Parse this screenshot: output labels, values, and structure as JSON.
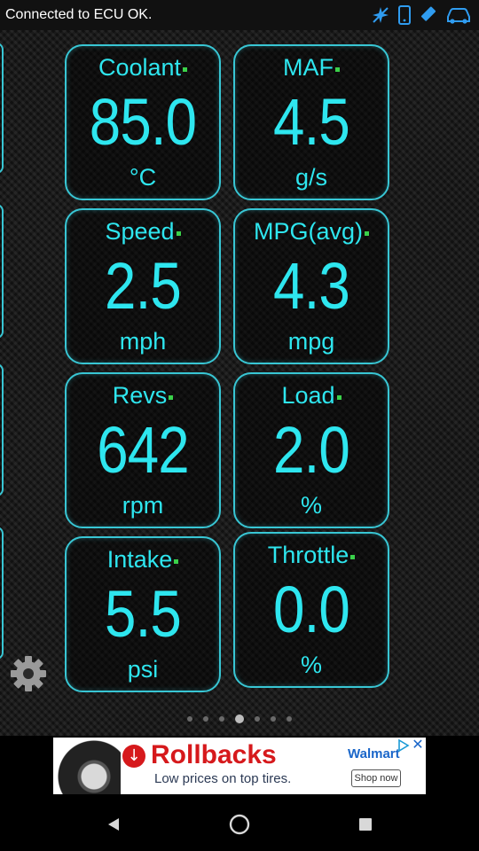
{
  "status_bar": {
    "text": "Connected to ECU OK.",
    "icons": [
      "gps-off-icon",
      "phone-icon",
      "usb-icon",
      "car-icon"
    ]
  },
  "gauges": [
    {
      "label": "Coolant",
      "value": "85.0",
      "unit": "°C"
    },
    {
      "label": "MAF",
      "value": "4.5",
      "unit": "g/s"
    },
    {
      "label": "Speed",
      "value": "2.5",
      "unit": "mph"
    },
    {
      "label": "MPG(avg)",
      "value": "4.3",
      "unit": "mpg"
    },
    {
      "label": "Revs",
      "value": "642",
      "unit": "rpm"
    },
    {
      "label": "Load",
      "value": "2.0",
      "unit": "%"
    },
    {
      "label": "Intake",
      "value": "5.5",
      "unit": "psi"
    },
    {
      "label": "Throttle",
      "value": "0.0",
      "unit": "%"
    }
  ],
  "pager": {
    "pages": 7,
    "active_index": 3
  },
  "ad": {
    "title": "Rollbacks",
    "subtitle": "Low prices on top tires.",
    "brand": "Walmart",
    "cta": "Shop now"
  },
  "colors": {
    "accent": "#2ee6ef",
    "border": "#38c6d4",
    "indicator": "#3ad14a",
    "ad_red": "#d6191c"
  },
  "nav": [
    "back-icon",
    "home-icon",
    "recents-icon"
  ]
}
